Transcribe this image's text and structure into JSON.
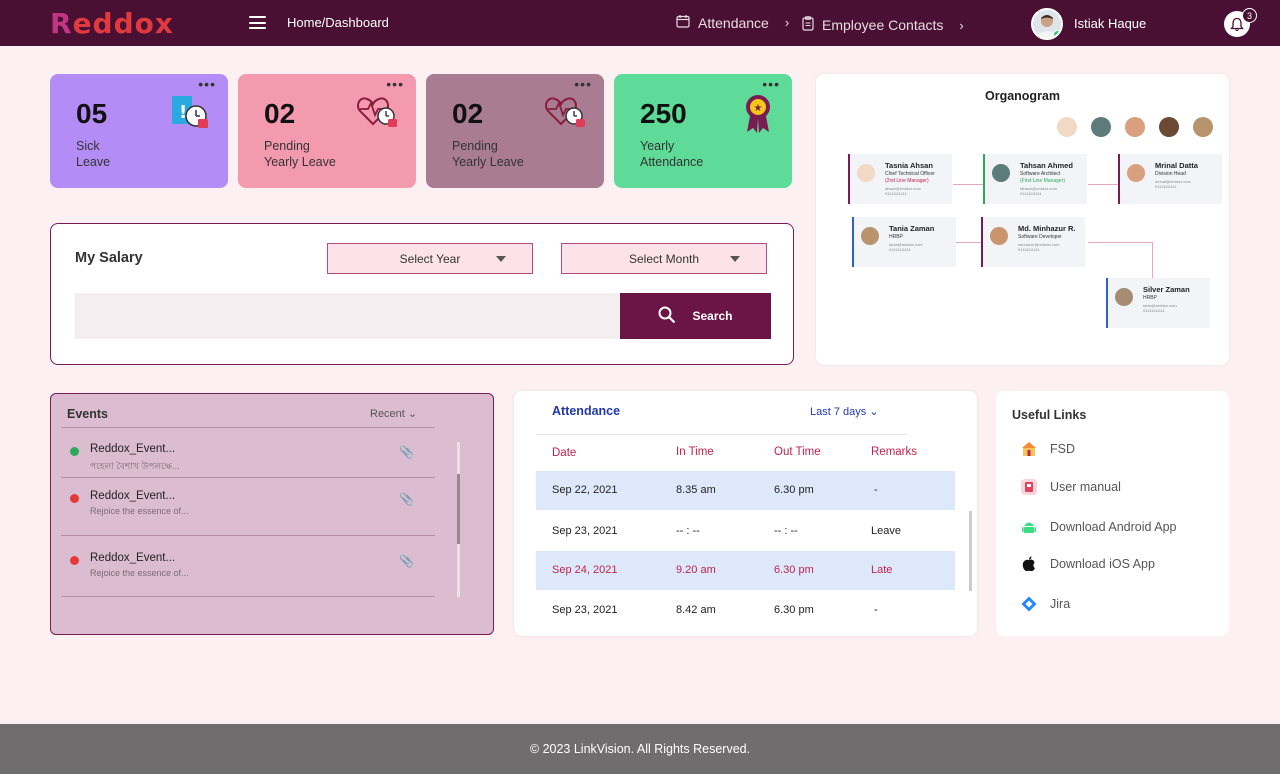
{
  "header": {
    "logo_text": "Reddox",
    "breadcrumb": "Home/Dashboard",
    "nav": [
      {
        "label": "Attendance",
        "icon": "calendar-icon"
      },
      {
        "label": "Employee Contacts",
        "icon": "clipboard-icon"
      }
    ],
    "user_name": "Istiak Haque",
    "notification_count": "3"
  },
  "stats": [
    {
      "value": "05",
      "label_line1": "Sick",
      "label_line2": "Leave",
      "color": "#b48cf5",
      "icon": "sick-leave-icon"
    },
    {
      "value": "02",
      "label_line1": "Pending",
      "label_line2": "Yearly Leave",
      "color": "#f39aaf",
      "icon": "heart-pulse-icon"
    },
    {
      "value": "02",
      "label_line1": "Pending",
      "label_line2": "Yearly Leave",
      "color": "#a97c92",
      "icon": "heart-pulse-icon"
    },
    {
      "value": "250",
      "label_line1": "Yearly",
      "label_line2": "Attendance",
      "color": "#5edb98",
      "icon": "award-ribbon-icon"
    }
  ],
  "salary": {
    "title": "My Salary",
    "select_year": "Select Year",
    "select_month": "Select Month",
    "search_label": "Search"
  },
  "organogram": {
    "title": "Organogram",
    "people": [
      {
        "name": "Tasnia Ahsan",
        "title": "Chief Technical Officer",
        "manager": "(2nd Line Manager)",
        "manager_color": "#c0224b",
        "email": "ahsan@reddox.com",
        "phone": "01111111111"
      },
      {
        "name": "Tahsan Ahmed",
        "title": "Software Architect",
        "manager": "(First Line Manager)",
        "manager_color": "#2ea85a",
        "email": "tahsan@reddox.com",
        "phone": "01111111111"
      },
      {
        "name": "Mrinal Datta",
        "title": "Division Head",
        "manager": "",
        "manager_color": "#333",
        "email": "mrinal@reddox.com",
        "phone": "01111111111"
      },
      {
        "name": "Tania Zaman",
        "title": "HRBP",
        "manager": "",
        "manager_color": "#333",
        "email": "tania@reddox.com",
        "phone": "01111111111"
      },
      {
        "name": "Md. Minhazur R.",
        "title": "Software Developer",
        "manager": "",
        "manager_color": "#333",
        "email": "minhazur@reddox.com",
        "phone": "01111111111"
      },
      {
        "name": "Silver Zaman",
        "title": "HRBP",
        "manager": "",
        "manager_color": "#333",
        "email": "tania@reddox.com",
        "phone": "01111111111"
      }
    ]
  },
  "events": {
    "title": "Events",
    "filter": "Recent",
    "items": [
      {
        "title": "Reddox_Event...",
        "subtitle": "পহেলা বৈশাখ উপলক্ষে...",
        "status_color": "#2ea85a"
      },
      {
        "title": "Reddox_Event...",
        "subtitle": "Rejoice the essence of...",
        "status_color": "#e53935"
      },
      {
        "title": "Reddox_Event...",
        "subtitle": "Rejoice the essence of...",
        "status_color": "#e53935"
      }
    ]
  },
  "attendance": {
    "title": "Attendance",
    "filter": "Last 7 days",
    "columns": [
      "Date",
      "In Time",
      "Out Time",
      "Remarks"
    ],
    "rows": [
      {
        "date": "Sep 22, 2021",
        "in": "8.35 am",
        "out": "6.30 pm",
        "remarks": "-",
        "highlight": true,
        "late": false
      },
      {
        "date": "Sep 23, 2021",
        "in": "-- : --",
        "out": "-- : --",
        "remarks": "Leave",
        "highlight": false,
        "late": false
      },
      {
        "date": "Sep 24, 2021",
        "in": "9.20 am",
        "out": "6.30 pm",
        "remarks": "Late",
        "highlight": true,
        "late": true
      },
      {
        "date": "Sep 23, 2021",
        "in": "8.42 am",
        "out": "6.30 pm",
        "remarks": "-",
        "highlight": false,
        "late": false
      }
    ]
  },
  "useful_links": {
    "title": "Useful Links",
    "items": [
      {
        "label": "FSD",
        "icon": "fsd-icon"
      },
      {
        "label": "User manual",
        "icon": "manual-icon"
      },
      {
        "label": "Download Android App",
        "icon": "android-icon"
      },
      {
        "label": "Download iOS App",
        "icon": "apple-icon"
      },
      {
        "label": "Jira",
        "icon": "jira-icon"
      }
    ]
  },
  "footer": {
    "text": "© 2023 LinkVision. All Rights Reserved."
  }
}
